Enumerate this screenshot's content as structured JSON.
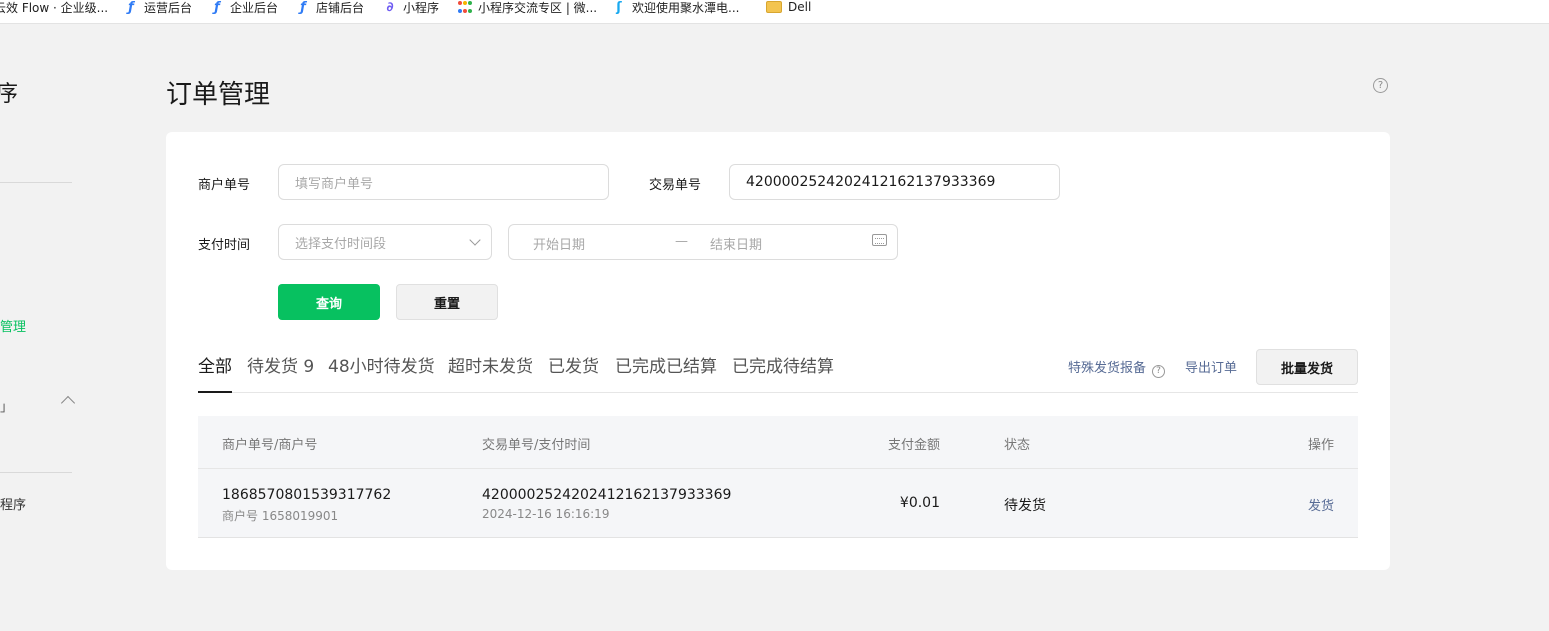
{
  "bookmarks": [
    {
      "icon": "flow-icon",
      "label": "云效 Flow · 企业级..."
    },
    {
      "icon": "feishu-icon",
      "label": "运营后台"
    },
    {
      "icon": "feishu-icon",
      "label": "企业后台"
    },
    {
      "icon": "feishu-icon",
      "label": "店铺后台"
    },
    {
      "icon": "link-icon",
      "label": "小程序"
    },
    {
      "icon": "apps-grid-icon",
      "label": "小程序交流专区 | 微..."
    },
    {
      "icon": "water-drop-icon",
      "label": "欢迎使用聚水潭电..."
    },
    {
      "icon": "folder-icon",
      "label": "Dell"
    }
  ],
  "sidebar": {
    "title": "序",
    "active_item": "管理",
    "item_collapsible": "」",
    "item_bottom": "程序"
  },
  "page": {
    "title": "订单管理",
    "help_icon": "?"
  },
  "filters": {
    "merchant_order_label": "商户单号",
    "merchant_order_placeholder": "填写商户单号",
    "transaction_no_label": "交易单号",
    "transaction_no_value": "4200002524202412162137933369",
    "pay_time_label": "支付时间",
    "pay_time_select_placeholder": "选择支付时间段",
    "start_date_placeholder": "开始日期",
    "range_separator": "—",
    "end_date_placeholder": "结束日期",
    "query_button": "查询",
    "reset_button": "重置"
  },
  "tabs": [
    {
      "label": "全部",
      "active": true
    },
    {
      "label": "待发货 9",
      "active": false
    },
    {
      "label": "48小时待发货",
      "active": false
    },
    {
      "label": "超时未发货",
      "active": false
    },
    {
      "label": "已发货",
      "active": false
    },
    {
      "label": "已完成已结算",
      "active": false
    },
    {
      "label": "已完成待结算",
      "active": false
    }
  ],
  "actions": {
    "special_report": "特殊发货报备",
    "export_orders": "导出订单",
    "batch_ship": "批量发货"
  },
  "table": {
    "columns": [
      "商户单号/商户号",
      "交易单号/支付时间",
      "支付金额",
      "状态",
      "操作"
    ],
    "rows": [
      {
        "merchant_order_no": "1868570801539317762",
        "merchant_id": "商户号 1658019901",
        "transaction_no": "4200002524202412162137933369",
        "pay_time": "2024-12-16 16:16:19",
        "amount": "¥0.01",
        "status": "待发货",
        "action": "发货"
      }
    ]
  },
  "colors": {
    "primary_green": "#07c160",
    "link_blue": "#576b95",
    "page_bg": "#f2f2f2"
  }
}
